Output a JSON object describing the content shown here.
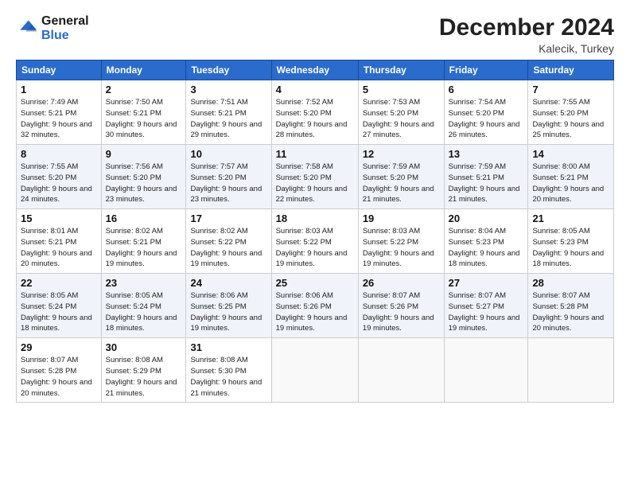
{
  "logo": {
    "line1": "General",
    "line2": "Blue"
  },
  "title": "December 2024",
  "location": "Kalecik, Turkey",
  "days_header": [
    "Sunday",
    "Monday",
    "Tuesday",
    "Wednesday",
    "Thursday",
    "Friday",
    "Saturday"
  ],
  "weeks": [
    [
      {
        "day": "1",
        "sunrise": "Sunrise: 7:49 AM",
        "sunset": "Sunset: 5:21 PM",
        "daylight": "Daylight: 9 hours and 32 minutes."
      },
      {
        "day": "2",
        "sunrise": "Sunrise: 7:50 AM",
        "sunset": "Sunset: 5:21 PM",
        "daylight": "Daylight: 9 hours and 30 minutes."
      },
      {
        "day": "3",
        "sunrise": "Sunrise: 7:51 AM",
        "sunset": "Sunset: 5:21 PM",
        "daylight": "Daylight: 9 hours and 29 minutes."
      },
      {
        "day": "4",
        "sunrise": "Sunrise: 7:52 AM",
        "sunset": "Sunset: 5:20 PM",
        "daylight": "Daylight: 9 hours and 28 minutes."
      },
      {
        "day": "5",
        "sunrise": "Sunrise: 7:53 AM",
        "sunset": "Sunset: 5:20 PM",
        "daylight": "Daylight: 9 hours and 27 minutes."
      },
      {
        "day": "6",
        "sunrise": "Sunrise: 7:54 AM",
        "sunset": "Sunset: 5:20 PM",
        "daylight": "Daylight: 9 hours and 26 minutes."
      },
      {
        "day": "7",
        "sunrise": "Sunrise: 7:55 AM",
        "sunset": "Sunset: 5:20 PM",
        "daylight": "Daylight: 9 hours and 25 minutes."
      }
    ],
    [
      {
        "day": "8",
        "sunrise": "Sunrise: 7:55 AM",
        "sunset": "Sunset: 5:20 PM",
        "daylight": "Daylight: 9 hours and 24 minutes."
      },
      {
        "day": "9",
        "sunrise": "Sunrise: 7:56 AM",
        "sunset": "Sunset: 5:20 PM",
        "daylight": "Daylight: 9 hours and 23 minutes."
      },
      {
        "day": "10",
        "sunrise": "Sunrise: 7:57 AM",
        "sunset": "Sunset: 5:20 PM",
        "daylight": "Daylight: 9 hours and 23 minutes."
      },
      {
        "day": "11",
        "sunrise": "Sunrise: 7:58 AM",
        "sunset": "Sunset: 5:20 PM",
        "daylight": "Daylight: 9 hours and 22 minutes."
      },
      {
        "day": "12",
        "sunrise": "Sunrise: 7:59 AM",
        "sunset": "Sunset: 5:20 PM",
        "daylight": "Daylight: 9 hours and 21 minutes."
      },
      {
        "day": "13",
        "sunrise": "Sunrise: 7:59 AM",
        "sunset": "Sunset: 5:21 PM",
        "daylight": "Daylight: 9 hours and 21 minutes."
      },
      {
        "day": "14",
        "sunrise": "Sunrise: 8:00 AM",
        "sunset": "Sunset: 5:21 PM",
        "daylight": "Daylight: 9 hours and 20 minutes."
      }
    ],
    [
      {
        "day": "15",
        "sunrise": "Sunrise: 8:01 AM",
        "sunset": "Sunset: 5:21 PM",
        "daylight": "Daylight: 9 hours and 20 minutes."
      },
      {
        "day": "16",
        "sunrise": "Sunrise: 8:02 AM",
        "sunset": "Sunset: 5:21 PM",
        "daylight": "Daylight: 9 hours and 19 minutes."
      },
      {
        "day": "17",
        "sunrise": "Sunrise: 8:02 AM",
        "sunset": "Sunset: 5:22 PM",
        "daylight": "Daylight: 9 hours and 19 minutes."
      },
      {
        "day": "18",
        "sunrise": "Sunrise: 8:03 AM",
        "sunset": "Sunset: 5:22 PM",
        "daylight": "Daylight: 9 hours and 19 minutes."
      },
      {
        "day": "19",
        "sunrise": "Sunrise: 8:03 AM",
        "sunset": "Sunset: 5:22 PM",
        "daylight": "Daylight: 9 hours and 19 minutes."
      },
      {
        "day": "20",
        "sunrise": "Sunrise: 8:04 AM",
        "sunset": "Sunset: 5:23 PM",
        "daylight": "Daylight: 9 hours and 18 minutes."
      },
      {
        "day": "21",
        "sunrise": "Sunrise: 8:05 AM",
        "sunset": "Sunset: 5:23 PM",
        "daylight": "Daylight: 9 hours and 18 minutes."
      }
    ],
    [
      {
        "day": "22",
        "sunrise": "Sunrise: 8:05 AM",
        "sunset": "Sunset: 5:24 PM",
        "daylight": "Daylight: 9 hours and 18 minutes."
      },
      {
        "day": "23",
        "sunrise": "Sunrise: 8:05 AM",
        "sunset": "Sunset: 5:24 PM",
        "daylight": "Daylight: 9 hours and 18 minutes."
      },
      {
        "day": "24",
        "sunrise": "Sunrise: 8:06 AM",
        "sunset": "Sunset: 5:25 PM",
        "daylight": "Daylight: 9 hours and 19 minutes."
      },
      {
        "day": "25",
        "sunrise": "Sunrise: 8:06 AM",
        "sunset": "Sunset: 5:26 PM",
        "daylight": "Daylight: 9 hours and 19 minutes."
      },
      {
        "day": "26",
        "sunrise": "Sunrise: 8:07 AM",
        "sunset": "Sunset: 5:26 PM",
        "daylight": "Daylight: 9 hours and 19 minutes."
      },
      {
        "day": "27",
        "sunrise": "Sunrise: 8:07 AM",
        "sunset": "Sunset: 5:27 PM",
        "daylight": "Daylight: 9 hours and 19 minutes."
      },
      {
        "day": "28",
        "sunrise": "Sunrise: 8:07 AM",
        "sunset": "Sunset: 5:28 PM",
        "daylight": "Daylight: 9 hours and 20 minutes."
      }
    ],
    [
      {
        "day": "29",
        "sunrise": "Sunrise: 8:07 AM",
        "sunset": "Sunset: 5:28 PM",
        "daylight": "Daylight: 9 hours and 20 minutes."
      },
      {
        "day": "30",
        "sunrise": "Sunrise: 8:08 AM",
        "sunset": "Sunset: 5:29 PM",
        "daylight": "Daylight: 9 hours and 21 minutes."
      },
      {
        "day": "31",
        "sunrise": "Sunrise: 8:08 AM",
        "sunset": "Sunset: 5:30 PM",
        "daylight": "Daylight: 9 hours and 21 minutes."
      },
      null,
      null,
      null,
      null
    ]
  ]
}
